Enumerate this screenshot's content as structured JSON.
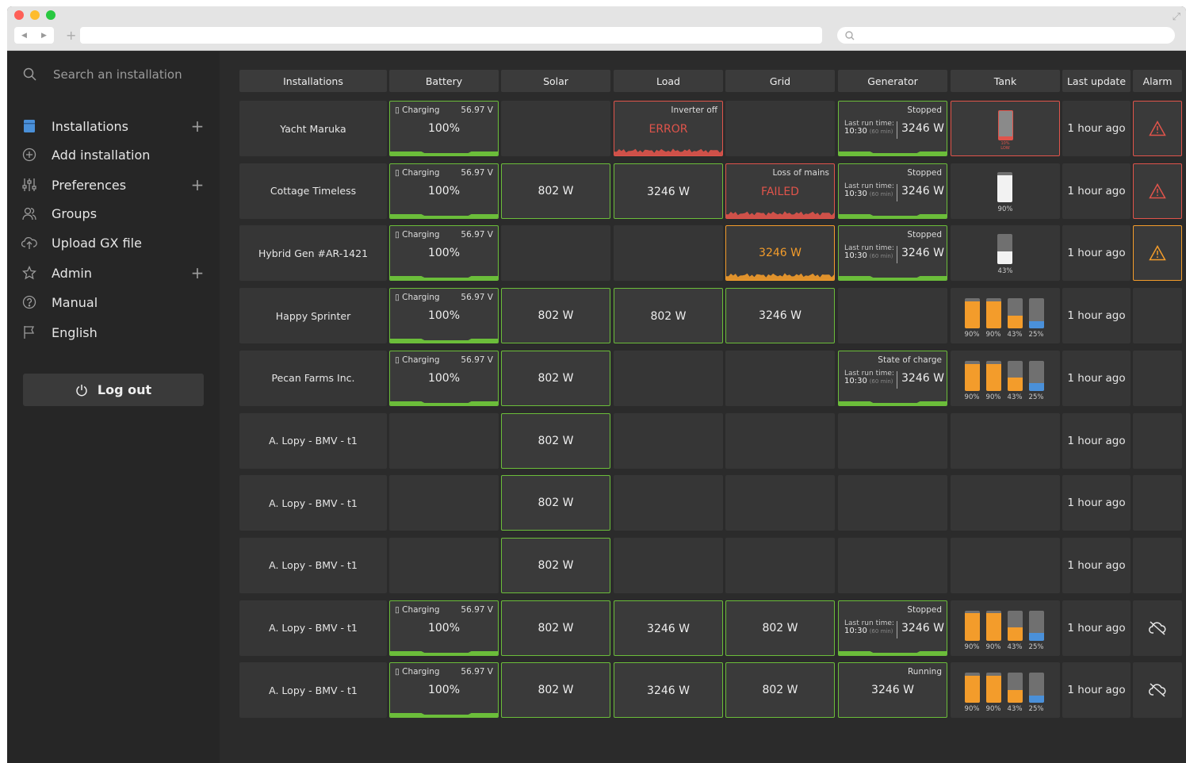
{
  "search": {
    "placeholder": "Search an installation"
  },
  "sidebar": {
    "items": [
      {
        "label": "Installations",
        "icon": "installations-icon",
        "has_add": true
      },
      {
        "label": "Add installation",
        "icon": "add-circle-icon",
        "has_add": false
      },
      {
        "label": "Preferences",
        "icon": "sliders-icon",
        "has_add": true
      },
      {
        "label": "Groups",
        "icon": "groups-icon",
        "has_add": false
      },
      {
        "label": "Upload GX file",
        "icon": "cloud-upload-icon",
        "has_add": false
      },
      {
        "label": "Admin",
        "icon": "star-icon",
        "has_add": true
      },
      {
        "label": "Manual",
        "icon": "help-icon",
        "has_add": false
      },
      {
        "label": "English",
        "icon": "flag-icon",
        "has_add": false
      }
    ],
    "logout": "Log out"
  },
  "colors": {
    "green": "#6bbd3a",
    "red": "#e0544b",
    "orange": "#f39c2b",
    "blue": "#4a90d9",
    "tank_gray": "#707070"
  },
  "table": {
    "headers": [
      "Installations",
      "Battery",
      "Solar",
      "Load",
      "Grid",
      "Generator",
      "Tank",
      "Last update",
      "Alarm"
    ],
    "rows": [
      {
        "name": "Yacht Maruka",
        "battery": {
          "status": "Charging",
          "voltage": "56.97 V",
          "soc": "100%"
        },
        "solar": null,
        "load": {
          "state": "r",
          "label": "Inverter off",
          "value": "ERROR"
        },
        "grid": null,
        "generator": {
          "mode": "lastrun",
          "top": "Stopped",
          "lastrun_label": "Last run time:",
          "lastrun_time": "10:30",
          "lastrun_dur": "(60 min)",
          "value": "3246 W"
        },
        "tank": {
          "mode": "single",
          "level": 0.1,
          "fill": "#e0544b",
          "label1": "10%",
          "label2": "LOW",
          "state": "r"
        },
        "last": "1 hour ago",
        "alarm": "warning-red"
      },
      {
        "name": "Cottage Timeless",
        "battery": {
          "status": "Charging",
          "voltage": "56.97 V",
          "soc": "100%"
        },
        "solar": {
          "value": "802 W"
        },
        "load": {
          "state": "g",
          "value": "3246 W"
        },
        "grid": {
          "state": "r",
          "label": "Loss of mains",
          "value": "FAILED"
        },
        "generator": {
          "mode": "lastrun",
          "top": "Stopped",
          "lastrun_label": "Last run time:",
          "lastrun_time": "10:30",
          "lastrun_dur": "(60 min)",
          "value": "3246 W"
        },
        "tank": {
          "mode": "single",
          "level": 0.9,
          "fill": "#f2f2f2",
          "label1": "90%"
        },
        "last": "1 hour ago",
        "alarm": "warning-red"
      },
      {
        "name": "Hybrid Gen #AR-1421",
        "battery": {
          "status": "Charging",
          "voltage": "56.97 V",
          "soc": "100%"
        },
        "solar": null,
        "load": null,
        "grid": {
          "state": "o",
          "value": "3246 W"
        },
        "generator": {
          "mode": "lastrun",
          "top": "Stopped",
          "lastrun_label": "Last run time:",
          "lastrun_time": "10:30",
          "lastrun_dur": "(60 min)",
          "value": "3246 W"
        },
        "tank": {
          "mode": "single",
          "level": 0.43,
          "fill": "#f2f2f2",
          "label1": "43%"
        },
        "last": "1 hour ago",
        "alarm": "warning-orange"
      },
      {
        "name": "Happy Sprinter",
        "battery": {
          "status": "Charging",
          "voltage": "56.97 V",
          "soc": "100%"
        },
        "solar": {
          "value": "802 W"
        },
        "load": {
          "state": "g",
          "value": "802 W"
        },
        "grid": {
          "state": "g",
          "value": "3246 W"
        },
        "generator": null,
        "tank": {
          "mode": "multi",
          "levels": [
            0.9,
            0.9,
            0.43,
            0.25
          ],
          "labels": [
            "90%",
            "90%",
            "43%",
            "25%"
          ]
        },
        "last": "1 hour ago",
        "alarm": null
      },
      {
        "name": "Pecan Farms Inc.",
        "battery": {
          "status": "Charging",
          "voltage": "56.97 V",
          "soc": "100%"
        },
        "solar": {
          "value": "802 W"
        },
        "load": null,
        "grid": null,
        "generator": {
          "mode": "lastrun",
          "top": "State of charge",
          "lastrun_label": "Last run time:",
          "lastrun_time": "10:30",
          "lastrun_dur": "(60 min)",
          "value": "3246 W"
        },
        "tank": {
          "mode": "multi",
          "levels": [
            0.9,
            0.9,
            0.43,
            0.25
          ],
          "labels": [
            "90%",
            "90%",
            "43%",
            "25%"
          ]
        },
        "last": "1 hour ago",
        "alarm": null
      },
      {
        "name": "A. Lopy - BMV - t1",
        "battery": null,
        "solar": {
          "value": "802 W"
        },
        "load": null,
        "grid": null,
        "generator": null,
        "tank": null,
        "last": "1 hour ago",
        "alarm": null
      },
      {
        "name": "A. Lopy - BMV - t1",
        "battery": null,
        "solar": {
          "value": "802 W"
        },
        "load": null,
        "grid": null,
        "generator": null,
        "tank": null,
        "last": "1 hour ago",
        "alarm": null
      },
      {
        "name": "A. Lopy - BMV - t1",
        "battery": null,
        "solar": {
          "value": "802 W"
        },
        "load": null,
        "grid": null,
        "generator": null,
        "tank": null,
        "last": "1 hour ago",
        "alarm": null
      },
      {
        "name": "A. Lopy - BMV - t1",
        "battery": {
          "status": "Charging",
          "voltage": "56.97 V",
          "soc": "100%"
        },
        "solar": {
          "value": "802 W"
        },
        "load": {
          "state": "g",
          "value": "3246 W"
        },
        "grid": {
          "state": "g",
          "value": "802 W"
        },
        "generator": {
          "mode": "lastrun",
          "top": "Stopped",
          "lastrun_label": "Last run time:",
          "lastrun_time": "10:30",
          "lastrun_dur": "(60 min)",
          "value": "3246 W"
        },
        "tank": {
          "mode": "multi",
          "levels": [
            0.9,
            0.9,
            0.43,
            0.25
          ],
          "labels": [
            "90%",
            "90%",
            "43%",
            "25%"
          ]
        },
        "last": "1 hour ago",
        "alarm": "cloud-off"
      },
      {
        "name": "A. Lopy - BMV - t1",
        "battery": {
          "status": "Charging",
          "voltage": "56.97 V",
          "soc": "100%"
        },
        "solar": {
          "value": "802 W"
        },
        "load": {
          "state": "g",
          "value": "3246 W"
        },
        "grid": {
          "state": "g",
          "value": "802 W"
        },
        "generator": {
          "mode": "simple",
          "top": "Running",
          "value": "3246 W"
        },
        "tank": {
          "mode": "multi",
          "levels": [
            0.9,
            0.9,
            0.43,
            0.25
          ],
          "labels": [
            "90%",
            "90%",
            "43%",
            "25%"
          ]
        },
        "last": "1 hour ago",
        "alarm": "cloud-off"
      }
    ]
  }
}
